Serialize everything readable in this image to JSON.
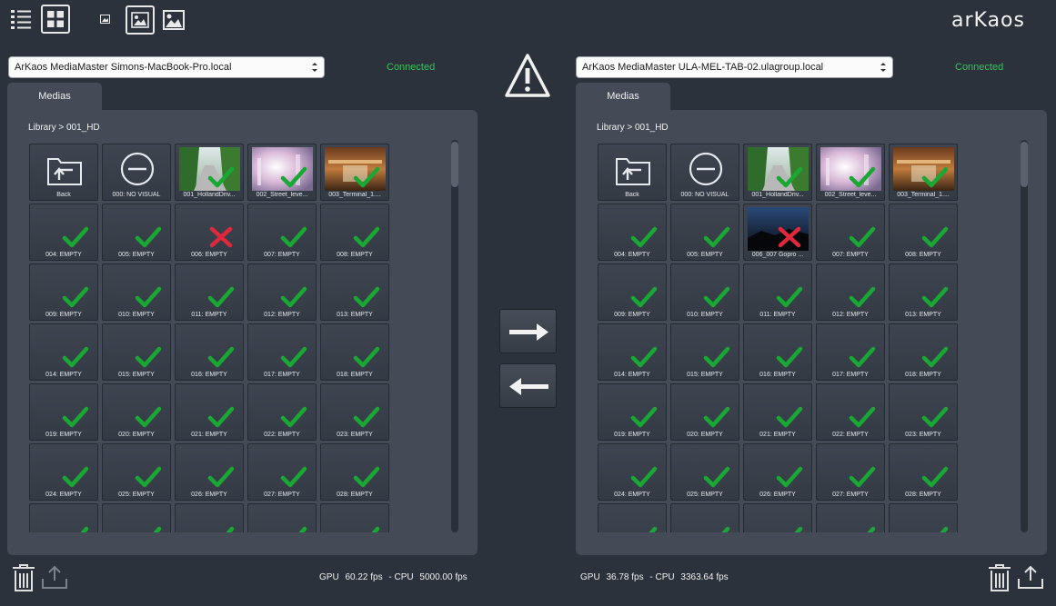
{
  "app": {
    "logo": "arKaos"
  },
  "toolbar": {
    "items": [
      {
        "name": "list-view-icon"
      },
      {
        "name": "grid-view-icon"
      },
      {
        "name": "thumbnail-small-icon"
      },
      {
        "name": "thumbnail-medium-icon"
      },
      {
        "name": "thumbnail-large-icon"
      }
    ]
  },
  "left": {
    "server": "ArKaos MediaMaster Simons-MacBook-Pro.local",
    "status": "Connected",
    "tab": "Medias",
    "breadcrumb": "Library > 001_HD",
    "gpu_label": "GPU",
    "gpu_fps": "60.22 fps",
    "sep": "- CPU",
    "cpu_fps": "5000.00 fps",
    "cells": [
      {
        "label": "Back",
        "kind": "back"
      },
      {
        "label": "000: NO VISUAL",
        "kind": "novisual"
      },
      {
        "label": "001_HollandDriv...",
        "kind": "thumb",
        "thumb": "road",
        "mark": "ok"
      },
      {
        "label": "002_Street_leve...",
        "kind": "thumb",
        "thumb": "street",
        "mark": "ok"
      },
      {
        "label": "003_Terminal_1....",
        "kind": "thumb",
        "thumb": "terminal",
        "mark": "ok"
      },
      {
        "label": "004: EMPTY",
        "mark": "ok"
      },
      {
        "label": "005: EMPTY",
        "mark": "ok"
      },
      {
        "label": "006: EMPTY",
        "mark": "err"
      },
      {
        "label": "007: EMPTY",
        "mark": "ok"
      },
      {
        "label": "008: EMPTY",
        "mark": "ok"
      },
      {
        "label": "009: EMPTY",
        "mark": "ok"
      },
      {
        "label": "010: EMPTY",
        "mark": "ok"
      },
      {
        "label": "011: EMPTY",
        "mark": "ok"
      },
      {
        "label": "012: EMPTY",
        "mark": "ok"
      },
      {
        "label": "013: EMPTY",
        "mark": "ok"
      },
      {
        "label": "014: EMPTY",
        "mark": "ok"
      },
      {
        "label": "015: EMPTY",
        "mark": "ok"
      },
      {
        "label": "016: EMPTY",
        "mark": "ok"
      },
      {
        "label": "017: EMPTY",
        "mark": "ok"
      },
      {
        "label": "018: EMPTY",
        "mark": "ok"
      },
      {
        "label": "019: EMPTY",
        "mark": "ok"
      },
      {
        "label": "020: EMPTY",
        "mark": "ok"
      },
      {
        "label": "021: EMPTY",
        "mark": "ok"
      },
      {
        "label": "022: EMPTY",
        "mark": "ok"
      },
      {
        "label": "023: EMPTY",
        "mark": "ok"
      },
      {
        "label": "024: EMPTY",
        "mark": "ok"
      },
      {
        "label": "025: EMPTY",
        "mark": "ok"
      },
      {
        "label": "026: EMPTY",
        "mark": "ok"
      },
      {
        "label": "027: EMPTY",
        "mark": "ok"
      },
      {
        "label": "028: EMPTY",
        "mark": "ok"
      },
      {
        "label": "",
        "mark": "ok"
      },
      {
        "label": "",
        "mark": "ok"
      },
      {
        "label": "",
        "mark": "ok"
      },
      {
        "label": "",
        "mark": "ok"
      },
      {
        "label": "",
        "mark": "ok"
      }
    ]
  },
  "right": {
    "server": "ArKaos MediaMaster ULA-MEL-TAB-02.ulagroup.local",
    "status": "Connected",
    "tab": "Medias",
    "breadcrumb": "Library > 001_HD",
    "gpu_label": "GPU",
    "gpu_fps": "36.78 fps",
    "sep": "- CPU",
    "cpu_fps": "3363.64 fps",
    "cells": [
      {
        "label": "Back",
        "kind": "back"
      },
      {
        "label": "000: NO VISUAL",
        "kind": "novisual"
      },
      {
        "label": "001_HollandDriv...",
        "kind": "thumb",
        "thumb": "road",
        "mark": "ok"
      },
      {
        "label": "002_Street_leve...",
        "kind": "thumb",
        "thumb": "street",
        "mark": "ok"
      },
      {
        "label": "003_Terminal_1....",
        "kind": "thumb",
        "thumb": "terminal",
        "mark": "ok"
      },
      {
        "label": "004: EMPTY",
        "mark": "ok"
      },
      {
        "label": "005: EMPTY",
        "mark": "ok"
      },
      {
        "label": "006_007 Gopro ...",
        "kind": "thumb",
        "thumb": "night",
        "mark": "err"
      },
      {
        "label": "007: EMPTY",
        "mark": "ok"
      },
      {
        "label": "008: EMPTY",
        "mark": "ok"
      },
      {
        "label": "009: EMPTY",
        "mark": "ok"
      },
      {
        "label": "010: EMPTY",
        "mark": "ok"
      },
      {
        "label": "011: EMPTY",
        "mark": "ok"
      },
      {
        "label": "012: EMPTY",
        "mark": "ok"
      },
      {
        "label": "013: EMPTY",
        "mark": "ok"
      },
      {
        "label": "014: EMPTY",
        "mark": "ok"
      },
      {
        "label": "015: EMPTY",
        "mark": "ok"
      },
      {
        "label": "016: EMPTY",
        "mark": "ok"
      },
      {
        "label": "017: EMPTY",
        "mark": "ok"
      },
      {
        "label": "018: EMPTY",
        "mark": "ok"
      },
      {
        "label": "019: EMPTY",
        "mark": "ok"
      },
      {
        "label": "020: EMPTY",
        "mark": "ok"
      },
      {
        "label": "021: EMPTY",
        "mark": "ok"
      },
      {
        "label": "022: EMPTY",
        "mark": "ok"
      },
      {
        "label": "023: EMPTY",
        "mark": "ok"
      },
      {
        "label": "024: EMPTY",
        "mark": "ok"
      },
      {
        "label": "025: EMPTY",
        "mark": "ok"
      },
      {
        "label": "026: EMPTY",
        "mark": "ok"
      },
      {
        "label": "027: EMPTY",
        "mark": "ok"
      },
      {
        "label": "028: EMPTY",
        "mark": "ok"
      },
      {
        "label": "",
        "mark": "ok"
      },
      {
        "label": "",
        "mark": "ok"
      },
      {
        "label": "",
        "mark": "ok"
      },
      {
        "label": "",
        "mark": "ok"
      },
      {
        "label": "",
        "mark": "ok"
      }
    ]
  },
  "center": {
    "warning": "warning-icon",
    "push_right": "arrow-right-icon",
    "push_left": "arrow-left-icon"
  },
  "colors": {
    "background": "#2c323b",
    "panel": "#444b56",
    "connected": "#35c35a",
    "ok_mark": "#19a834",
    "error_mark": "#e0283c"
  }
}
